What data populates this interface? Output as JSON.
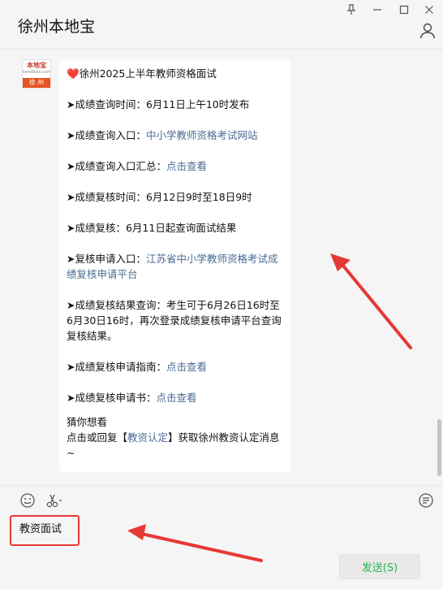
{
  "window": {
    "title": "徐州本地宝",
    "controls": [
      "pin-icon",
      "minimize-icon",
      "maximize-icon",
      "close-icon"
    ]
  },
  "avatar": {
    "top_text": "本地宝",
    "sub_text": "bendibao.com",
    "bottom_text": "徐 州"
  },
  "message": {
    "heading_icon": "❤️",
    "heading": "徐州2025上半年教师资格面试",
    "items": [
      {
        "label": "➤成绩查询时间：6月11日上午10时发布",
        "link": ""
      },
      {
        "label": "➤成绩查询入口：",
        "link": "中小学教师资格考试网站"
      },
      {
        "label": "➤成绩查询入口汇总：",
        "link": "点击查看"
      },
      {
        "label": "➤成绩复核时间：6月12日9时至18日9时",
        "link": ""
      },
      {
        "label": "➤成绩复核：6月11日起查询面试结果",
        "link": ""
      },
      {
        "label": "➤复核申请入口：",
        "link": "江苏省中小学教师资格考试成绩复核申请平台"
      },
      {
        "label": "➤成绩复核结果查询：考生可于6月26日16时至6月30日16时，再次登录成绩复核申请平台查询复核结果。",
        "link": ""
      },
      {
        "label": "➤成绩复核申请指南：",
        "link": "点击查看"
      },
      {
        "label": "➤成绩复核申请书：",
        "link": "点击查看"
      }
    ],
    "footer_line1": "猜你想看",
    "footer_pre": "点击或回复【",
    "footer_link": "教资认定",
    "footer_post": "】获取徐州教资认定消息~"
  },
  "toolbar": {
    "icons": [
      "emoji-icon",
      "scissors-icon",
      "chat-history-icon"
    ]
  },
  "input": {
    "value": "教资面试"
  },
  "send_button": {
    "label": "发送(S)"
  },
  "colors": {
    "link": "#4a6b95",
    "arrow": "#e53935",
    "send_text": "#2fb04e"
  }
}
